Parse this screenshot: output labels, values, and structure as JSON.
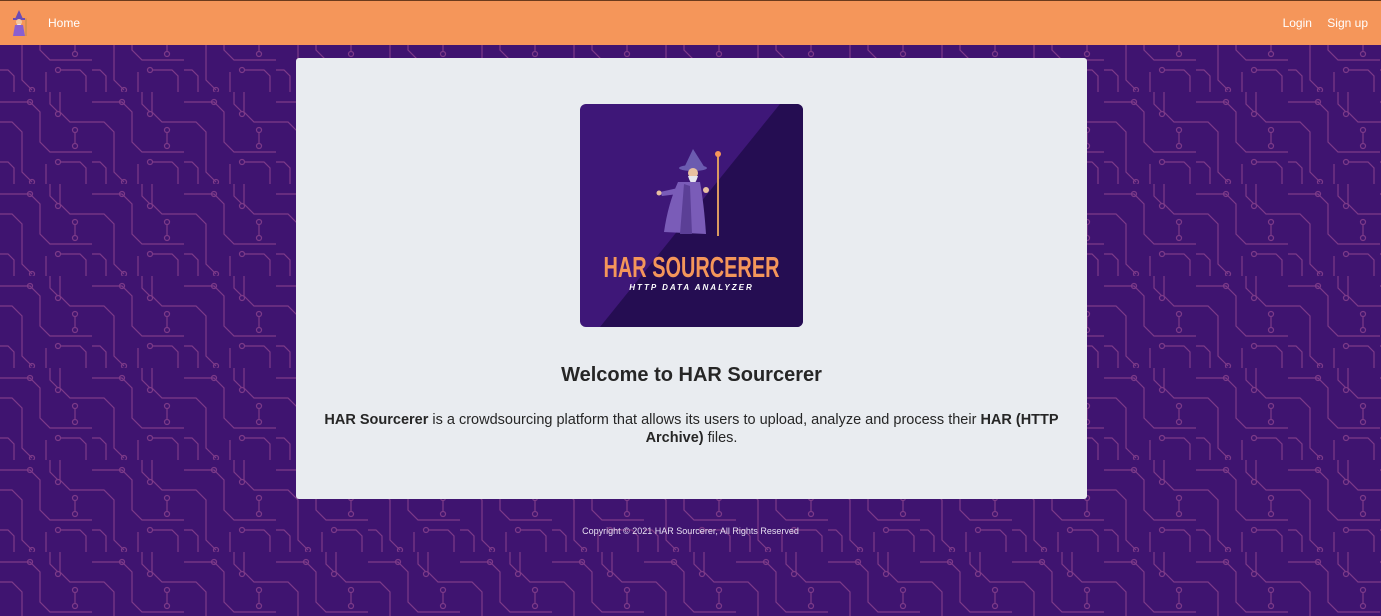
{
  "nav": {
    "logo_icon": "wizard-icon",
    "home_label": "Home",
    "login_label": "Login",
    "signup_label": "Sign up"
  },
  "hero": {
    "logo_title": "HAR SOURCERER",
    "logo_subtitle": "HTTP DATA ANALYZER",
    "welcome_title": "Welcome to HAR Sourcerer",
    "description": {
      "brand": "HAR Sourcerer",
      "middle": " is a crowdsourcing platform that allows its users to upload, analyze and process their ",
      "format": "HAR (HTTP Archive)",
      "end": " files."
    }
  },
  "footer": {
    "copyright": "Copyright © 2021 HAR Sourcerer, All Rights Reserved"
  },
  "colors": {
    "navbar": "#f5965a",
    "background": "#3f1470",
    "circuit_lines": "#7d3a88",
    "card": "#e9ecf0",
    "logo_title": "#f5965a"
  }
}
